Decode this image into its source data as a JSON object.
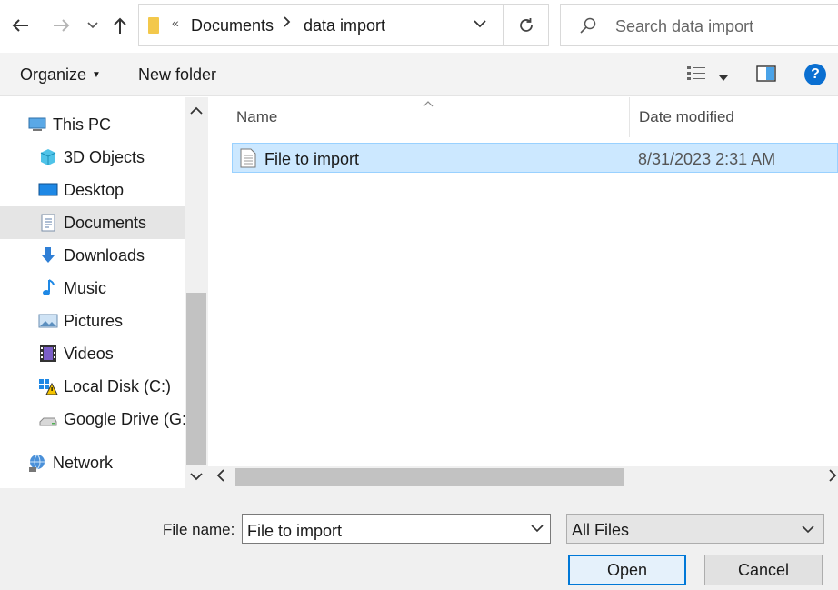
{
  "address": {
    "overflow_glyph": "«",
    "crumbs": [
      "Documents",
      "data import"
    ]
  },
  "search": {
    "placeholder": "Search data import"
  },
  "toolbar": {
    "organize": "Organize",
    "new_folder": "New folder",
    "help_glyph": "?"
  },
  "sidebar": {
    "items": [
      {
        "label": "This PC",
        "icon": "computer-icon"
      },
      {
        "label": "3D Objects",
        "icon": "cube-icon"
      },
      {
        "label": "Desktop",
        "icon": "desktop-icon"
      },
      {
        "label": "Documents",
        "icon": "document-icon",
        "selected": true
      },
      {
        "label": "Downloads",
        "icon": "download-arrow-icon"
      },
      {
        "label": "Music",
        "icon": "music-note-icon"
      },
      {
        "label": "Pictures",
        "icon": "picture-icon"
      },
      {
        "label": "Videos",
        "icon": "film-icon"
      },
      {
        "label": "Local Disk (C:)",
        "icon": "drive-warning-icon"
      },
      {
        "label": "Google Drive (G:)",
        "icon": "drive-icon"
      },
      {
        "label": "Network",
        "icon": "network-icon"
      }
    ]
  },
  "filelist": {
    "columns": [
      "Name",
      "Date modified"
    ],
    "rows": [
      {
        "name": "File to import",
        "date": "8/31/2023 2:31 AM",
        "selected": true
      }
    ]
  },
  "bottom": {
    "file_name_label": "File name:",
    "file_name_value": "File to import",
    "filter_value": "All Files",
    "open_label": "Open",
    "cancel_label": "Cancel"
  },
  "colors": {
    "selection": "#cce8ff",
    "accent": "#0078d7",
    "folder": "#f3c84b"
  }
}
